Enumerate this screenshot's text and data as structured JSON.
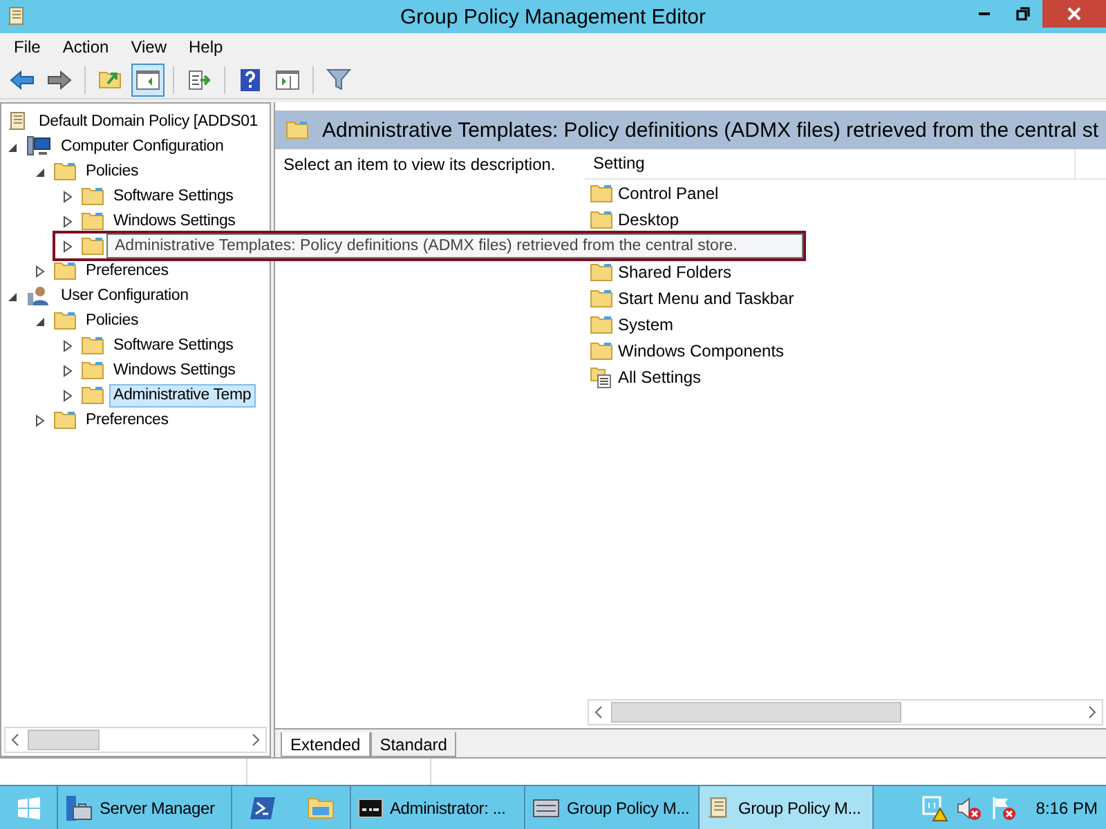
{
  "window": {
    "title": "Group Policy Management Editor"
  },
  "menu": [
    "File",
    "Action",
    "View",
    "Help"
  ],
  "toolbar": [
    [
      {
        "kind": "back",
        "selected": false
      },
      {
        "kind": "forward",
        "selected": false
      }
    ],
    [
      {
        "kind": "up",
        "selected": false
      },
      {
        "kind": "tree-toggle",
        "selected": true
      }
    ],
    [
      {
        "kind": "export",
        "selected": false
      }
    ],
    [
      {
        "kind": "help",
        "selected": false
      },
      {
        "kind": "action-pane",
        "selected": false
      }
    ],
    [
      {
        "kind": "filter",
        "selected": false
      }
    ]
  ],
  "tree": [
    {
      "kind": "policy",
      "label": "Default Domain Policy [ADDS01",
      "selected": false,
      "children": [
        {
          "kind": "computer",
          "label": "Computer Configuration",
          "expanded": true,
          "selected": false,
          "children": [
            {
              "kind": "folder",
              "label": "Policies",
              "expanded": true,
              "selected": false,
              "children": [
                {
                  "kind": "folder",
                  "label": "Software Settings",
                  "expanded": false,
                  "selected": false
                },
                {
                  "kind": "folder",
                  "label": "Windows Settings",
                  "expanded": false,
                  "selected": false
                },
                {
                  "kind": "folder",
                  "expanded": false
                }
              ]
            },
            {
              "kind": "folder",
              "label": "Preferences",
              "expanded": false,
              "selected": false
            }
          ]
        },
        {
          "kind": "user",
          "label": "User Configuration",
          "expanded": true,
          "selected": false,
          "children": [
            {
              "kind": "folder",
              "label": "Policies",
              "expanded": true,
              "selected": false,
              "children": [
                {
                  "kind": "folder",
                  "label": "Software Settings",
                  "expanded": false,
                  "selected": false
                },
                {
                  "kind": "folder",
                  "label": "Windows Settings",
                  "expanded": false,
                  "selected": false
                },
                {
                  "kind": "folder",
                  "label": "Administrative Temp",
                  "expanded": false,
                  "selected": true
                }
              ]
            },
            {
              "kind": "folder",
              "label": "Preferences",
              "expanded": false,
              "selected": false
            }
          ]
        }
      ]
    }
  ],
  "details": {
    "heading": "Administrative Templates: Policy definitions (ADMX files) retrieved from the central st",
    "description": "Select an item to view its description.",
    "columns": [
      "Setting"
    ],
    "items": [
      {
        "kind": "folder",
        "label": "Control Panel"
      },
      {
        "kind": "folder",
        "label": "Desktop"
      },
      {
        "kind": "folder"
      },
      {
        "kind": "folder",
        "label": "Shared Folders"
      },
      {
        "kind": "folder",
        "label": "Start Menu and Taskbar"
      },
      {
        "kind": "folder",
        "label": "System"
      },
      {
        "kind": "folder",
        "label": "Windows Components"
      },
      {
        "kind": "all-settings",
        "label": "All Settings"
      }
    ],
    "tabs": [
      {
        "label": "Extended",
        "selected": true
      },
      {
        "label": "Standard",
        "selected": false
      }
    ]
  },
  "tooltip": "Administrative Templates: Policy definitions (ADMX files) retrieved from the central store.",
  "taskbar": {
    "buttons": [
      {
        "kind": "start",
        "selected": false
      },
      {
        "kind": "server-manager",
        "label": "Server Manager",
        "selected": false
      },
      {
        "kind": "powershell",
        "selected": false
      },
      {
        "kind": "explorer",
        "selected": false
      },
      {
        "kind": "console",
        "label": "Administrator: ...",
        "selected": false
      },
      {
        "kind": "gpm",
        "label": "Group Policy M...",
        "selected": false
      },
      {
        "kind": "policy",
        "label": "Group Policy M...",
        "selected": true
      }
    ],
    "clock": "8:16 PM"
  }
}
